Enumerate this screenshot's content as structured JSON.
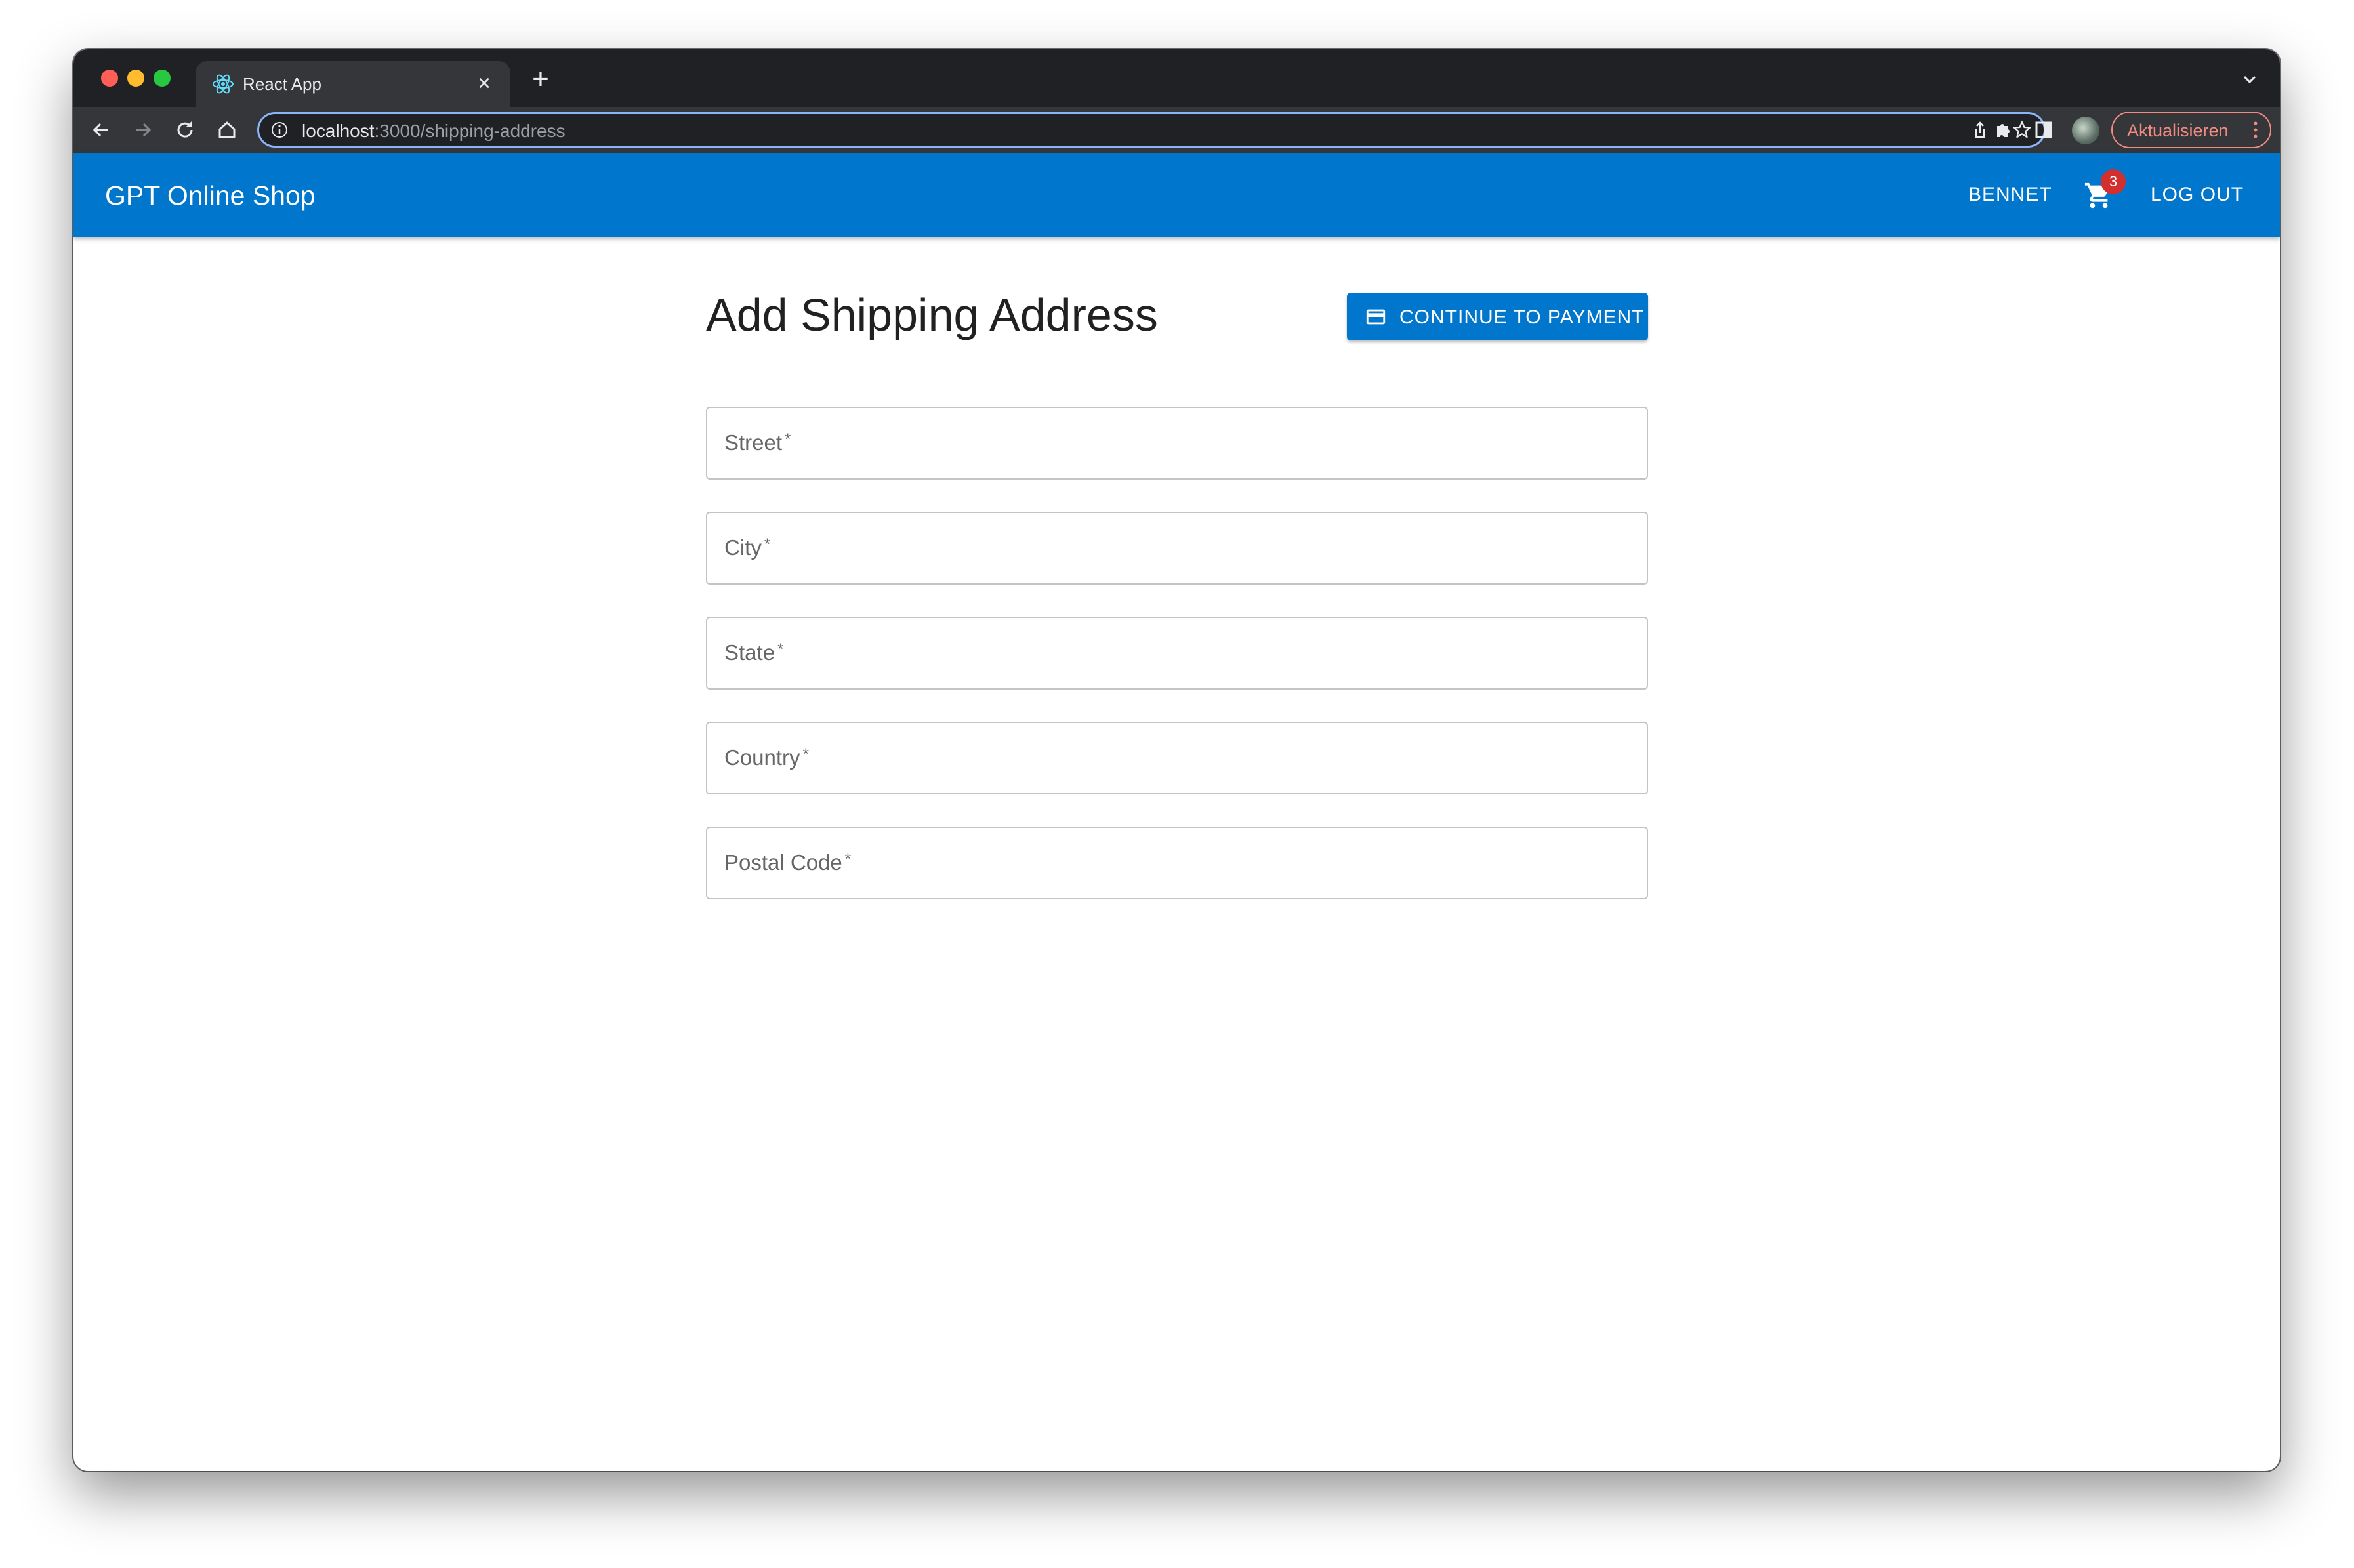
{
  "browser": {
    "tab_title": "React App",
    "url_host": "localhost",
    "url_path": ":3000/shipping-address",
    "update_label": "Aktualisieren"
  },
  "appbar": {
    "brand": "GPT Online Shop",
    "user_label": "BENNET",
    "cart_count": "3",
    "logout_label": "LOG OUT"
  },
  "main": {
    "title": "Add Shipping Address",
    "continue_label": "CONTINUE TO PAYMENT",
    "fields": [
      {
        "label": "Street",
        "required": "*"
      },
      {
        "label": "City",
        "required": "*"
      },
      {
        "label": "State",
        "required": "*"
      },
      {
        "label": "Country",
        "required": "*"
      },
      {
        "label": "Postal Code",
        "required": "*"
      }
    ]
  },
  "colors": {
    "primary": "#0076cc",
    "badge": "#d32f2f",
    "browser_dark": "#202124",
    "browser_toolbar": "#35363a"
  },
  "icons": [
    "react-icon",
    "close-icon",
    "plus-icon",
    "chevron-down-icon",
    "back-icon",
    "forward-icon",
    "reload-icon",
    "home-icon",
    "info-icon",
    "share-icon",
    "star-icon",
    "extensions-icon",
    "sidepanel-icon",
    "more-icon",
    "cart-icon",
    "credit-card-icon"
  ]
}
